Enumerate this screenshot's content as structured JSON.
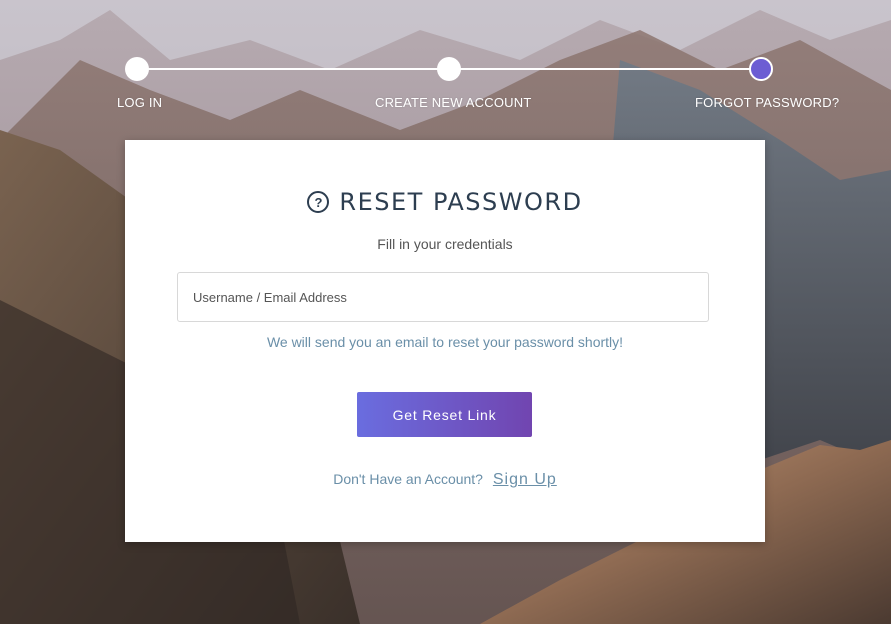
{
  "colors": {
    "accent": "#6c5dd3",
    "title": "#2d3e50",
    "hint": "#6a8fa8",
    "button_start": "#6a6ddf",
    "button_end": "#7145b0"
  },
  "stepper": {
    "steps": [
      {
        "label": "LOG IN",
        "state": "done"
      },
      {
        "label": "CREATE NEW ACCOUNT",
        "state": "done"
      },
      {
        "label": "FORGOT PASSWORD?",
        "state": "active"
      }
    ]
  },
  "card": {
    "icon": "question-circle-icon",
    "title": "RESET PASSWORD",
    "subtitle": "Fill in your credentials",
    "input": {
      "placeholder": "Username / Email Address",
      "value": ""
    },
    "hint": "We will send you an email to reset your password shortly!",
    "button_label": "Get Reset Link",
    "signup_prompt": "Don't Have an Account?",
    "signup_link": "Sign Up"
  }
}
